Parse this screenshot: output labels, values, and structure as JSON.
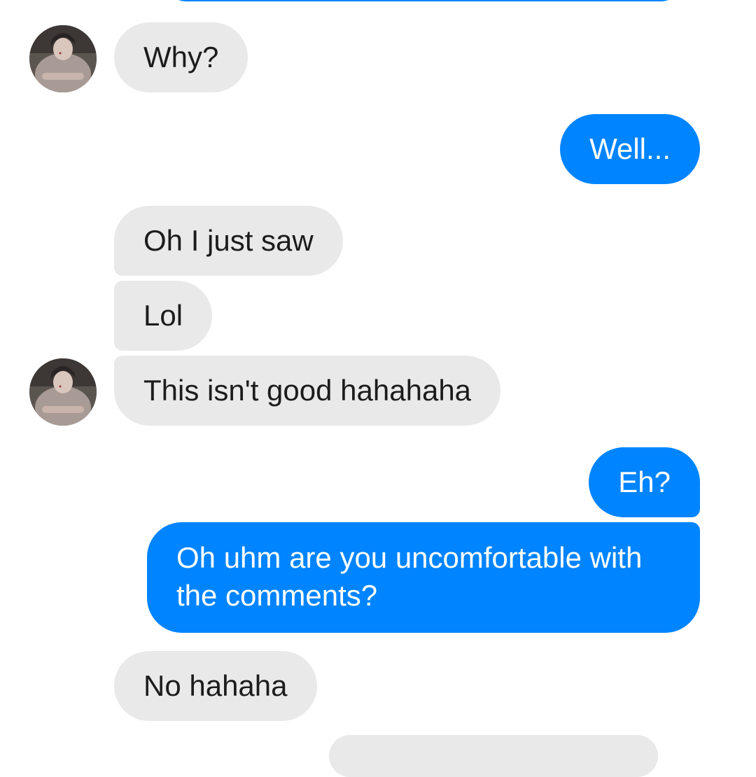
{
  "messages": [
    {
      "from": "them",
      "text": "Why?"
    },
    {
      "from": "me",
      "text": "Well..."
    },
    {
      "from": "them",
      "text": "Oh I just saw"
    },
    {
      "from": "them",
      "text": "Lol"
    },
    {
      "from": "them",
      "text": "This isn't good hahahaha"
    },
    {
      "from": "me",
      "text": "Eh?"
    },
    {
      "from": "me",
      "text": "Oh uhm are you uncomfortable with the comments?"
    },
    {
      "from": "them",
      "text": "No hahaha"
    }
  ],
  "colors": {
    "outgoing_bubble": "#0084ff",
    "incoming_bubble": "#e9e9e9",
    "incoming_text": "#1c1c1c",
    "outgoing_text": "#ffffff"
  },
  "icons": {
    "contact_avatar": "contact-avatar-photo"
  }
}
